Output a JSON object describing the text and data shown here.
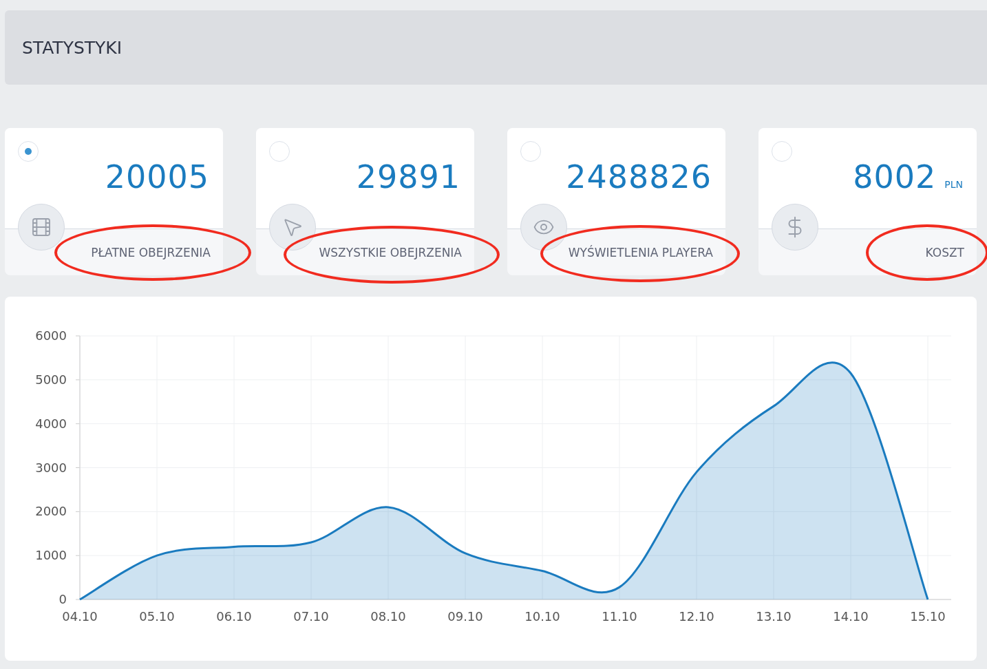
{
  "header": {
    "title": "STATYSTYKI"
  },
  "cards": [
    {
      "selected": true,
      "value": "20005",
      "label": "PŁATNE OBEJRZENIA",
      "highlighted": true
    },
    {
      "selected": false,
      "value": "29891",
      "label": "WSZYSTKIE OBEJRZENIA",
      "highlighted": true
    },
    {
      "selected": false,
      "value": "2488826",
      "label": "WYŚWIETLENIA PLAYERA",
      "highlighted": true
    },
    {
      "selected": false,
      "value": "8002",
      "unit": "PLN",
      "label": "KOSZT",
      "highlighted": true
    }
  ],
  "chart": {
    "chart_data": {
      "type": "area",
      "categories": [
        "04.10",
        "05.10",
        "06.10",
        "07.10",
        "08.10",
        "09.10",
        "10.10",
        "11.10",
        "12.10",
        "13.10",
        "14.10",
        "15.10"
      ],
      "grid": true,
      "series": [
        {
          "color": "#1a7bbf",
          "values": [
            0,
            1000,
            1200,
            1300,
            2100,
            1050,
            650,
            280,
            2900,
            4400,
            5150,
            0
          ]
        }
      ],
      "ylim": [
        0,
        6000
      ],
      "yticks": [
        0,
        1000,
        2000,
        3000,
        4000,
        5000,
        6000
      ]
    }
  }
}
